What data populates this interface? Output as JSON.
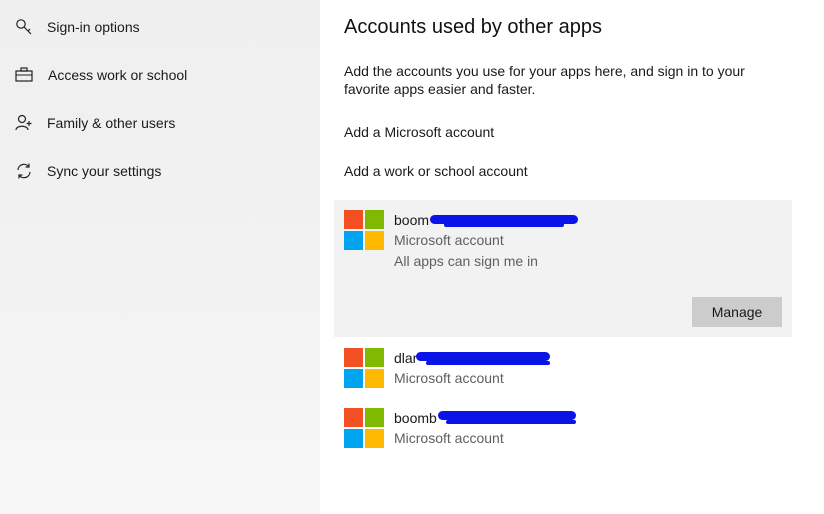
{
  "sidebar": {
    "items": [
      {
        "label": "Sign-in options",
        "icon": "key-icon"
      },
      {
        "label": "Access work or school",
        "icon": "briefcase-icon"
      },
      {
        "label": "Family & other users",
        "icon": "person-add-icon"
      },
      {
        "label": "Sync your settings",
        "icon": "sync-icon"
      }
    ]
  },
  "main": {
    "title": "Accounts used by other apps",
    "description": "Add the accounts you use for your apps here, and sign in to your favorite apps easier and faster.",
    "add_microsoft": "Add a Microsoft account",
    "add_work": "Add a work or school account",
    "accounts": [
      {
        "email_visible": "boom",
        "type": "Microsoft account",
        "status": "All apps can sign me in",
        "manage_label": "Manage"
      },
      {
        "email_visible": "dlar",
        "type": "Microsoft account"
      },
      {
        "email_visible": "boomb",
        "type": "Microsoft account"
      }
    ]
  },
  "colors": {
    "ms_red": "#f25022",
    "ms_green": "#7fba00",
    "ms_blue": "#00a4ef",
    "ms_yellow": "#ffb900",
    "redaction": "#0a14e6"
  }
}
